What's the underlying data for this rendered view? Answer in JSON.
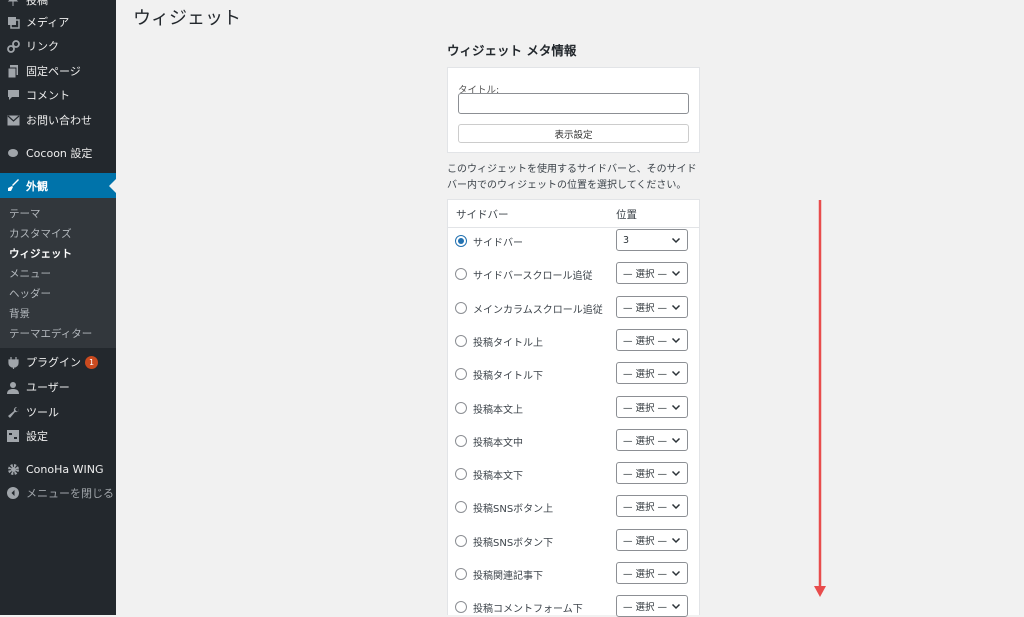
{
  "sidebar": {
    "menu": [
      {
        "id": "posts",
        "label": "投稿",
        "icon": "pin-icon"
      },
      {
        "id": "media",
        "label": "メディア",
        "icon": "media-icon"
      },
      {
        "id": "links",
        "label": "リンク",
        "icon": "link-icon"
      },
      {
        "id": "pages",
        "label": "固定ページ",
        "icon": "page-icon"
      },
      {
        "id": "comments",
        "label": "コメント",
        "icon": "comment-icon"
      },
      {
        "id": "contact",
        "label": "お問い合わせ",
        "icon": "mail-icon"
      },
      {
        "id": "cocoon",
        "label": "Cocoon 設定",
        "icon": "cocoon-icon"
      },
      {
        "id": "appearance",
        "label": "外観",
        "icon": "brush-icon"
      },
      {
        "id": "plugins",
        "label": "プラグイン",
        "icon": "plugin-icon",
        "badge": "1"
      },
      {
        "id": "users",
        "label": "ユーザー",
        "icon": "user-icon"
      },
      {
        "id": "tools",
        "label": "ツール",
        "icon": "wrench-icon"
      },
      {
        "id": "settings",
        "label": "設定",
        "icon": "settings-icon"
      },
      {
        "id": "conoha",
        "label": "ConoHa WING",
        "icon": "gear-icon"
      },
      {
        "id": "collapse",
        "label": "メニューを閉じる",
        "icon": "collapse-icon"
      }
    ],
    "submenu": [
      "テーマ",
      "カスタマイズ",
      "ウィジェット",
      "メニュー",
      "ヘッダー",
      "背景",
      "テーマエディター"
    ],
    "current_submenu": "ウィジェット"
  },
  "main": {
    "page_title": "ウィジェット",
    "widget_heading": "ウィジェット メタ情報",
    "title_label": "タイトル:",
    "title_value": "",
    "display_button": "表示設定",
    "description": "このウィジェットを使用するサイドバーと、そのサイドバー内でのウィジェットの位置を選択してください。",
    "table": {
      "col_sidebar": "サイドバー",
      "col_position": "位置",
      "rows": [
        {
          "label": "サイドバー",
          "checked": true,
          "position": "3"
        },
        {
          "label": "サイドバースクロール追従",
          "checked": false,
          "position": "— 選択 —"
        },
        {
          "label": "メインカラムスクロール追従",
          "checked": false,
          "position": "— 選択 —"
        },
        {
          "label": "投稿タイトル上",
          "checked": false,
          "position": "— 選択 —"
        },
        {
          "label": "投稿タイトル下",
          "checked": false,
          "position": "— 選択 —"
        },
        {
          "label": "投稿本文上",
          "checked": false,
          "position": "— 選択 —"
        },
        {
          "label": "投稿本文中",
          "checked": false,
          "position": "— 選択 —"
        },
        {
          "label": "投稿本文下",
          "checked": false,
          "position": "— 選択 —"
        },
        {
          "label": "投稿SNSボタン上",
          "checked": false,
          "position": "— 選択 —"
        },
        {
          "label": "投稿SNSボタン下",
          "checked": false,
          "position": "— 選択 —"
        },
        {
          "label": "投稿関連記事下",
          "checked": false,
          "position": "— 選択 —"
        },
        {
          "label": "投稿コメントフォーム下",
          "checked": false,
          "position": "— 選択 —"
        }
      ]
    }
  },
  "colors": {
    "sidebar_bg": "#23282d",
    "active_bg": "#0073aa",
    "badge": "#ca4a1f",
    "radio_checked": "#2271b1",
    "arrow": "#e84c4c"
  }
}
